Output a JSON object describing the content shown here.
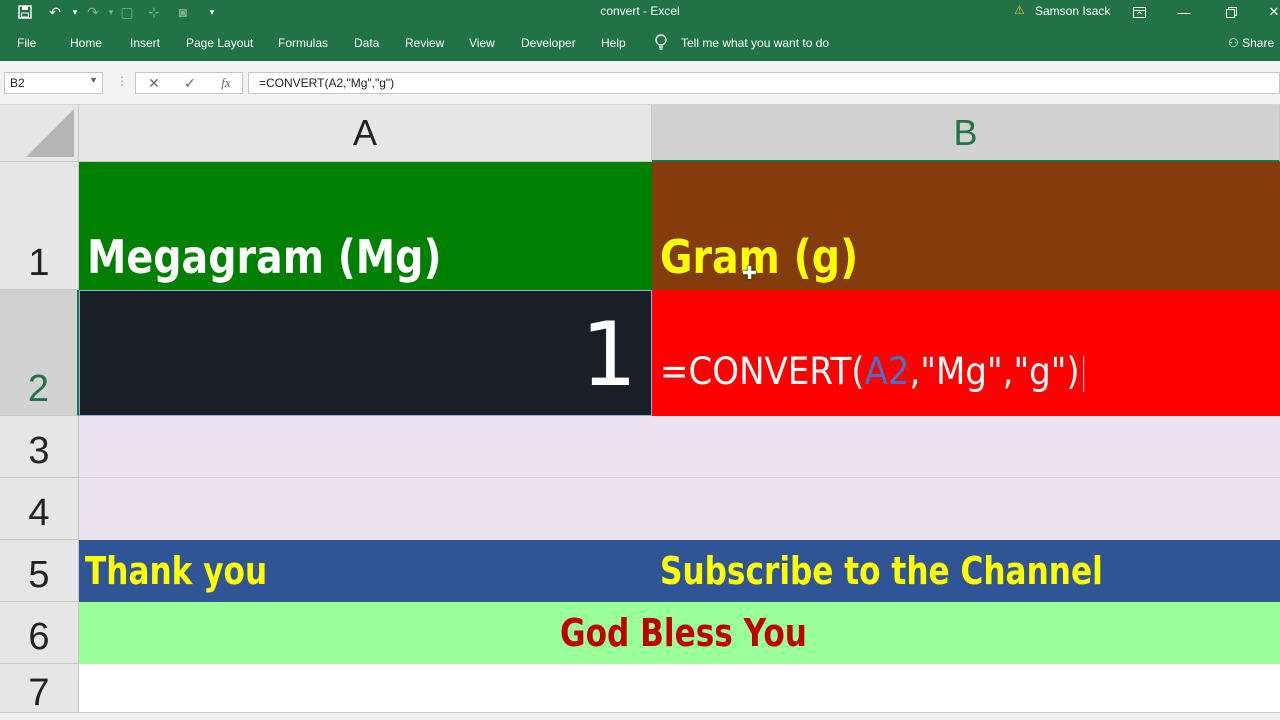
{
  "titlebar": {
    "title": "convert  -  Excel",
    "user": "Samson Isack",
    "icons": [
      "save-icon",
      "undo-icon",
      "redo-icon",
      "new-icon",
      "touch-mode-icon",
      "camera-icon",
      "customize-icon"
    ]
  },
  "ribbon": {
    "tabs": [
      "File",
      "Home",
      "Insert",
      "Page Layout",
      "Formulas",
      "Data",
      "Review",
      "View",
      "Developer",
      "Help"
    ],
    "tell_me": "Tell me what you want to do",
    "share": "Share"
  },
  "formula_bar": {
    "name_box": "B2",
    "cancel": "✕",
    "enter": "✓",
    "fx": "fx",
    "formula": "=CONVERT(A2,\"Mg\",\"g\")"
  },
  "grid": {
    "columns": [
      "A",
      "B"
    ],
    "rows": [
      "1",
      "2",
      "3",
      "4",
      "5",
      "6",
      "7"
    ],
    "cells": {
      "A1": "Megagram (Mg)",
      "B1": "Gram (g)",
      "A2": "1",
      "B2_prefix": "=CONVERT(",
      "B2_ref": "A2",
      "B2_suffix": ",\"Mg\",\"g\")",
      "A5": "Thank you",
      "B5": "Subscribe to the Channel",
      "A6": "God Bless You"
    }
  },
  "colors": {
    "excel_green": "#217346",
    "a1_fill": "#008000",
    "b1_fill": "#843c0c",
    "a2_fill": "#1a1f27",
    "b2_fill": "#ff0000",
    "rows_3_4_fill": "#ebe4f0",
    "row_5_fill": "#2f5597",
    "row_6_fill": "#99ff99",
    "yellow_text": "#ffff00",
    "red_text": "#c00000"
  }
}
